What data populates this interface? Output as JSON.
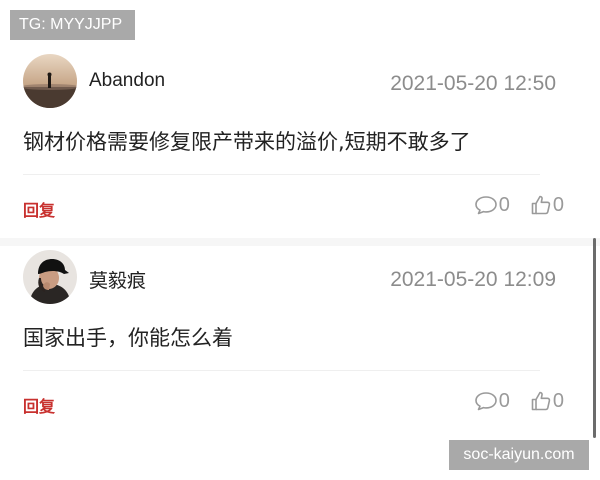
{
  "tag_label": "TG: MYYJJPP",
  "comments": [
    {
      "username": "Abandon",
      "timestamp": "2021-05-20 12:50",
      "content": "钢材价格需要修复限产带来的溢价,短期不敢多了",
      "reply_label": "回复",
      "comment_count": "0",
      "like_count": "0",
      "avatar_icon": "sunset-figure-avatar"
    },
    {
      "username": "莫毅痕",
      "timestamp": "2021-05-20 12:09",
      "content": "国家出手，你能怎么着",
      "reply_label": "回复",
      "comment_count": "0",
      "like_count": "0",
      "avatar_icon": "person-in-cap-avatar"
    }
  ],
  "watermark": "soc-kaiyun.com",
  "colors": {
    "accent_red": "#c8312f",
    "meta_gray": "#8c8c8c",
    "overlay_gray": "#a9a9a9"
  }
}
